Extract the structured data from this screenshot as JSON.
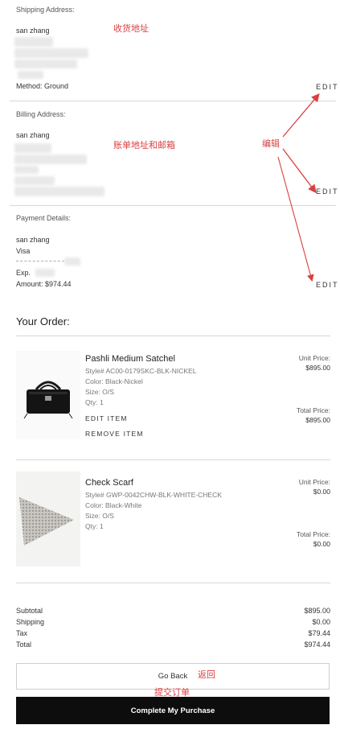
{
  "shipping": {
    "heading": "Shipping Address:",
    "name": "san zhang",
    "method": "Method: Ground",
    "edit_label": "EDIT",
    "annotation": "收货地址"
  },
  "billing": {
    "heading": "Billing Address:",
    "name": "san zhang",
    "edit_label": "EDIT",
    "annotation": "账单地址和邮箱"
  },
  "payment": {
    "heading": "Payment Details:",
    "name": "san zhang",
    "card_type": "Visa",
    "exp_label": "Exp.",
    "amount": "Amount: $974.44",
    "edit_label": "EDIT"
  },
  "edit_annotation": "编辑",
  "order": {
    "title": "Your Order:",
    "items": [
      {
        "name": "Pashli Medium Satchel",
        "style": "Style# AC00-0179SKC-BLK-NICKEL",
        "color": "Color: Black-Nickel",
        "size": "Size: O/S",
        "qty": "Qty: 1",
        "unit_price_label": "Unit Price:",
        "unit_price": "$895.00",
        "total_price_label": "Total Price:",
        "total_price": "$895.00",
        "edit_label": "EDIT ITEM",
        "remove_label": "REMOVE ITEM"
      },
      {
        "name": "Check Scarf",
        "style": "Style# GWP-0042CHW-BLK-WHITE-CHECK",
        "color": "Color: Black-White",
        "size": "Size: O/S",
        "qty": "Qty: 1",
        "unit_price_label": "Unit Price:",
        "unit_price": "$0.00",
        "total_price_label": "Total Price:",
        "total_price": "$0.00"
      }
    ]
  },
  "totals": {
    "subtotal_label": "Subtotal",
    "subtotal": "$895.00",
    "shipping_label": "Shipping",
    "shipping": "$0.00",
    "tax_label": "Tax",
    "tax": "$79.44",
    "total_label": "Total",
    "total": "$974.44"
  },
  "buttons": {
    "back_label": "Go Back",
    "back_annotation": "返回",
    "complete_label": "Complete My Purchase",
    "complete_annotation": "提交订单"
  },
  "colors": {
    "annotation": "#d94040",
    "button_dark": "#0d0d0d"
  }
}
